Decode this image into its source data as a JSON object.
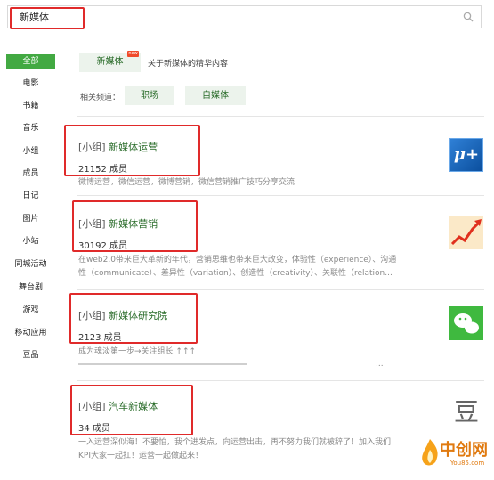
{
  "search": {
    "value": "新媒体",
    "icon": "search-icon"
  },
  "sidebar": {
    "items": [
      {
        "label": "全部",
        "active": true
      },
      {
        "label": "电影"
      },
      {
        "label": "书籍"
      },
      {
        "label": "音乐"
      },
      {
        "label": "小组"
      },
      {
        "label": "成员"
      },
      {
        "label": "日记"
      },
      {
        "label": "图片"
      },
      {
        "label": "小站"
      },
      {
        "label": "同城活动"
      },
      {
        "label": "舞台剧"
      },
      {
        "label": "游戏"
      },
      {
        "label": "移动应用"
      },
      {
        "label": "豆品"
      }
    ]
  },
  "header": {
    "tab_label": "新媒体",
    "badge": "new",
    "subtitle": "关于新媒体的精华内容",
    "related_label": "相关频道：",
    "related_channels": [
      "职场",
      "自媒体"
    ]
  },
  "results": [
    {
      "tag": "[小组]",
      "title": "新媒体运营",
      "count": "21152 成员",
      "desc1": "微博运营，微信运营，微博营销，微信营销推广技巧分享交流",
      "desc2": ""
    },
    {
      "tag": "[小组]",
      "title": "新媒体营销",
      "count": "30192 成员",
      "desc1": "在web2.0带来巨大革新的年代，营销思维也带来巨大改变，体验性（experience）、沟通",
      "desc2": "性（communicate）、差异性（variation）、创造性（creativity）、关联性（relation..."
    },
    {
      "tag": "[小组]",
      "title": "新媒体研究院",
      "count": "2123 成员",
      "desc1": "成为魂淡第一步→关注组长 ↑↑↑",
      "desc2": "..."
    },
    {
      "tag": "[小组]",
      "title": "汽车新媒体",
      "count": "34 成员",
      "desc1": "一入运营深似海！不要怕，我个进发点，向运营出击，再不努力我们就被辞了！加入我们",
      "desc2": "KPI大家一起扛！运营一起做起来！"
    }
  ],
  "thumbs": {
    "mu": "μ+",
    "douban": "豆"
  },
  "watermark": {
    "text": "中创网",
    "sub": "You85.com"
  },
  "colors": {
    "accent_green": "#42a942",
    "link_green": "#2a6c2a",
    "highlight_red": "#e02a2a"
  }
}
